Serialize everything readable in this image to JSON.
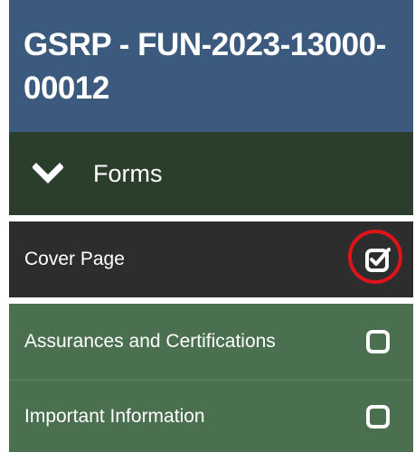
{
  "header": {
    "title": "GSRP - FUN-2023-13000-00012"
  },
  "forms_section": {
    "label": "Forms",
    "expanded": true,
    "icon": "chevron-down-icon"
  },
  "form_items": [
    {
      "label": "Cover Page",
      "checked": true,
      "selected": true,
      "icon": "checkbox-checked-icon"
    },
    {
      "label": "Assurances and Certifications",
      "checked": false,
      "selected": false,
      "icon": "checkbox-empty-icon"
    },
    {
      "label": "Important Information",
      "checked": false,
      "selected": false,
      "icon": "checkbox-empty-icon"
    }
  ],
  "colors": {
    "header_bg": "#3c5a7e",
    "forms_bg": "#2b3e2c",
    "active_item_bg": "#2d2d2d",
    "item_bg": "#4a7050",
    "highlight_ring": "#e0131a"
  }
}
